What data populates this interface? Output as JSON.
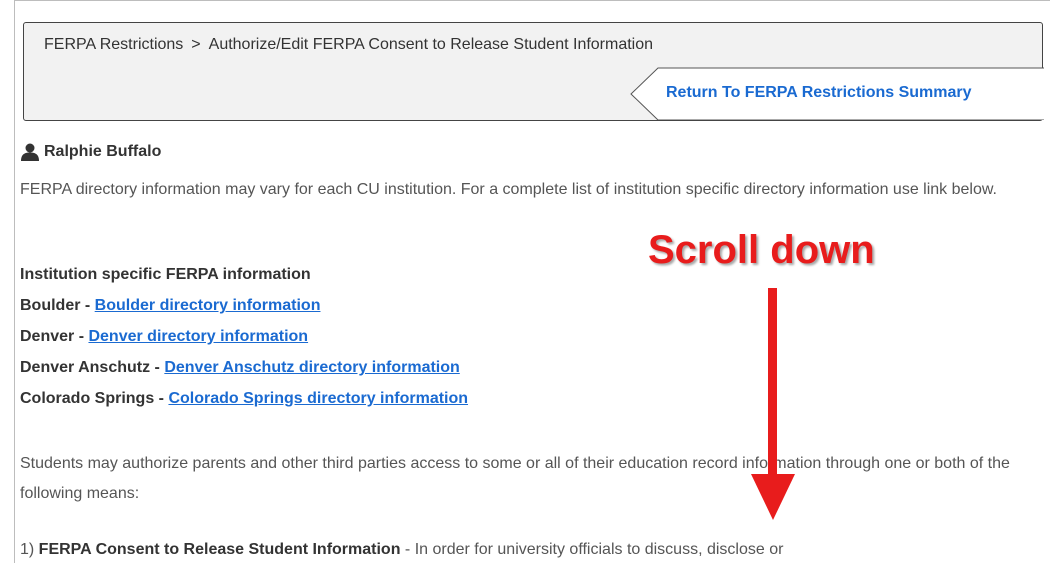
{
  "breadcrumb": {
    "item1": "FERPA Restrictions",
    "separator": ">",
    "item2": "Authorize/Edit FERPA Consent to Release Student Information"
  },
  "return_link": "Return To FERPA Restrictions Summary",
  "student": {
    "icon": "user-icon",
    "name": "Ralphie Buffalo"
  },
  "intro_paragraph": "FERPA directory information may vary for each CU institution. For a complete list of institution specific directory information use link below.",
  "institution_section": {
    "heading": "Institution specific FERPA information",
    "items": [
      {
        "label": "Boulder - ",
        "link": "Boulder directory information"
      },
      {
        "label": "Denver - ",
        "link": "Denver directory information"
      },
      {
        "label": "Denver Anschutz - ",
        "link": "Denver Anschutz directory information"
      },
      {
        "label": "Colorado Springs - ",
        "link": "Colorado Springs directory information"
      }
    ]
  },
  "access_paragraph": "Students may authorize parents and other third parties access to some or all of their education record information through one or both of the following means:",
  "consent_item": {
    "prefix": "1) ",
    "title": "FERPA Consent to Release Student Information",
    "text": " - In order for university officials to discuss, disclose or"
  },
  "annotation": {
    "label": "Scroll down",
    "color": "#e81c1c"
  },
  "colors": {
    "link": "#1a6ad1",
    "header_bg": "#f2f2f2"
  }
}
